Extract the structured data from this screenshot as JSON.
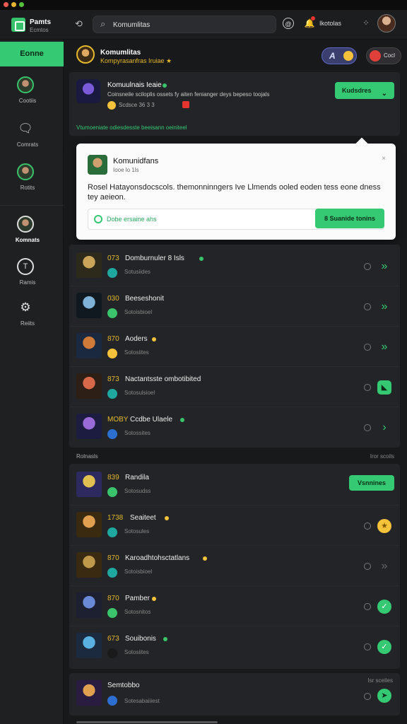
{
  "app": {
    "name": "Pamts",
    "subtitle": "Ecmtos"
  },
  "search": {
    "value": "Komumlitas"
  },
  "topbar": {
    "user_label": "Ikotolas"
  },
  "sidebar": {
    "online_label": "Eonne",
    "items": [
      {
        "label": "Cootiis",
        "icon": "avatar"
      },
      {
        "label": "Comrats",
        "icon": "chat-icon"
      },
      {
        "label": "Rotits",
        "icon": "avatar"
      },
      {
        "label": "Komnats",
        "icon": "avatar"
      },
      {
        "label": "Ramis",
        "icon": "t-icon"
      },
      {
        "label": "Reiits",
        "icon": "gear-icon"
      }
    ]
  },
  "room": {
    "title": "Komumlitas",
    "subtitle": "Kompyrasanfras Iruiae ★",
    "pill_a_text": "A",
    "pill_b_text": "Cocl"
  },
  "featured": {
    "title": "Komuulnais Ieaie",
    "description": "Coinsneile sciloplis ossets fy aiten fenianger deys bepeso toojals",
    "meta": "Scdsce 36 3 3",
    "button_label": "Kudsdres"
  },
  "promo_text": "Vtumoeniate odiesdesste beeisann oeiniteel",
  "popup": {
    "title": "Komunidfans",
    "subtitle": "Iooe lo 1ls",
    "body": "Rosel Hatayonsdocscols. themonninngers Ive Llmends ooled eoden tess eone dness tey aeieon.",
    "field_text": "Dobe ersaine ahs",
    "button_label": "8 Suanide tonins"
  },
  "list": [
    {
      "num": "073",
      "name": "Domburnuler 8 Isls",
      "sub": "Sotusiides",
      "dot": "#3ac36b",
      "thumb": [
        "#c9a45a",
        "#2d2a1c"
      ],
      "badge": "#1fa8a0",
      "action": "chevrons"
    },
    {
      "num": "030",
      "name": "Beeseshonit",
      "sub": "Sotoisbioel",
      "dot": "",
      "thumb": [
        "#7fb2d6",
        "#101820"
      ],
      "badge": "#3ac36b",
      "action": "chevrons"
    },
    {
      "num": "870",
      "name": "Aoders",
      "sub": "Sotosiites",
      "dot": "#f5c33b",
      "thumb": [
        "#d07a3a",
        "#1b2940"
      ],
      "badge": "#f5c33b",
      "action": "chevrons"
    },
    {
      "num": "873",
      "name": "Nactantsste ombotibited",
      "sub": "Sotosulsioel",
      "dot": "",
      "thumb": [
        "#d8684a",
        "#2d1e16"
      ],
      "badge": "#1fa8a0",
      "action": "chat"
    },
    {
      "num": "MOBY",
      "name": "Ccdbe Ulaele",
      "sub": "Sotossites",
      "dot": "#3ac36b",
      "thumb": [
        "#9a6ad8",
        "#1c1c40"
      ],
      "badge": "#2d6fd0",
      "action": "chevron"
    }
  ],
  "section": {
    "title": "Rolnasls",
    "right": "Iror scoils",
    "button_label": "Vsnnines"
  },
  "list2": [
    {
      "num": "839",
      "name": "Randila",
      "sub": "Sotosudss",
      "dot": "",
      "thumb": [
        "#e0c050",
        "#2d2a60"
      ],
      "badge": "#3ac36b",
      "action": "button"
    },
    {
      "num": "1738",
      "name": "Seaiteet",
      "sub": "Sotosules",
      "dot": "#f5c33b",
      "thumb": [
        "#e0a050",
        "#3a2a10"
      ],
      "badge": "#1fa8a0",
      "action": "coin"
    },
    {
      "num": "870",
      "name": "Karoadhtohsctatlans",
      "sub": "Sotoisbioel",
      "dot": "#f5c33b",
      "thumb": [
        "#c09a4a",
        "#3a2a12"
      ],
      "badge": "#1fa8a0",
      "action": "chevrons-dim"
    },
    {
      "num": "870",
      "name": "Pamber",
      "sub": "Sotosnitos",
      "dot": "#f5c33b",
      "thumb": [
        "#6a8ad8",
        "#1c2030"
      ],
      "badge": "#3ac36b",
      "action": "check"
    },
    {
      "num": "673",
      "name": "Souibonis",
      "sub": "Sotosiites",
      "dot": "#3ac36b",
      "thumb": [
        "#5ab0e0",
        "#1c2a40"
      ],
      "badge": "#1a1a1a",
      "action": "check"
    }
  ],
  "footer_row": {
    "name": "Semtobbo",
    "sub": "Sotesabaiiiest",
    "right": "Isr sceiles"
  },
  "colors": {
    "accent": "#34c972",
    "gold": "#e5b82d",
    "bg": "#18191b"
  }
}
